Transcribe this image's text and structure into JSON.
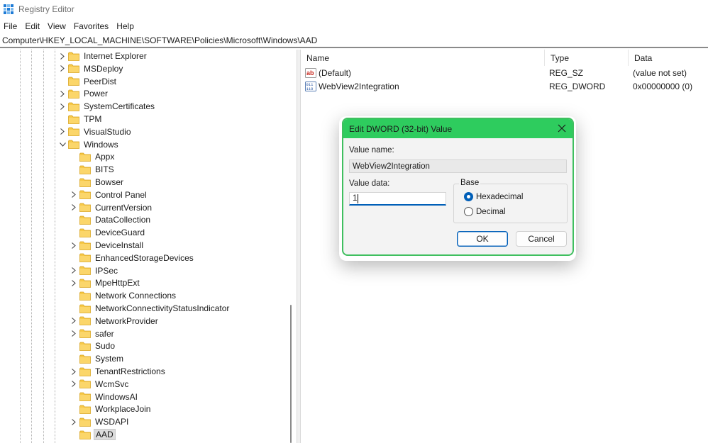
{
  "window": {
    "title": "Registry Editor",
    "icon": "registry-editor-icon"
  },
  "menu": [
    "File",
    "Edit",
    "View",
    "Favorites",
    "Help"
  ],
  "address": "Computer\\HKEY_LOCAL_MACHINE\\SOFTWARE\\Policies\\Microsoft\\Windows\\AAD",
  "tree": {
    "items": [
      {
        "label": "Internet Explorer",
        "expander": "collapsed"
      },
      {
        "label": "MSDeploy",
        "expander": "collapsed"
      },
      {
        "label": "PeerDist",
        "expander": "none"
      },
      {
        "label": "Power",
        "expander": "collapsed"
      },
      {
        "label": "SystemCertificates",
        "expander": "collapsed"
      },
      {
        "label": "TPM",
        "expander": "none"
      },
      {
        "label": "VisualStudio",
        "expander": "collapsed"
      },
      {
        "label": "Windows",
        "expander": "expanded"
      },
      {
        "label": "Appx",
        "expander": "none"
      },
      {
        "label": "BITS",
        "expander": "none"
      },
      {
        "label": "Bowser",
        "expander": "none"
      },
      {
        "label": "Control Panel",
        "expander": "collapsed"
      },
      {
        "label": "CurrentVersion",
        "expander": "collapsed"
      },
      {
        "label": "DataCollection",
        "expander": "none"
      },
      {
        "label": "DeviceGuard",
        "expander": "none"
      },
      {
        "label": "DeviceInstall",
        "expander": "collapsed"
      },
      {
        "label": "EnhancedStorageDevices",
        "expander": "none"
      },
      {
        "label": "IPSec",
        "expander": "collapsed"
      },
      {
        "label": "MpeHttpExt",
        "expander": "collapsed"
      },
      {
        "label": "Network Connections",
        "expander": "none"
      },
      {
        "label": "NetworkConnectivityStatusIndicator",
        "expander": "none"
      },
      {
        "label": "NetworkProvider",
        "expander": "collapsed"
      },
      {
        "label": "safer",
        "expander": "collapsed"
      },
      {
        "label": "Sudo",
        "expander": "none"
      },
      {
        "label": "System",
        "expander": "none"
      },
      {
        "label": "TenantRestrictions",
        "expander": "collapsed"
      },
      {
        "label": "WcmSvc",
        "expander": "collapsed"
      },
      {
        "label": "WindowsAI",
        "expander": "none"
      },
      {
        "label": "WorkplaceJoin",
        "expander": "none"
      },
      {
        "label": "WSDAPI",
        "expander": "collapsed"
      },
      {
        "label": "AAD",
        "expander": "none",
        "selected": true
      }
    ]
  },
  "list": {
    "columns": [
      "Name",
      "Type",
      "Data"
    ],
    "rows": [
      {
        "name": "(Default)",
        "type": "REG_SZ",
        "data": "(value not set)",
        "icon": "string-value-icon"
      },
      {
        "name": "WebView2Integration",
        "type": "REG_DWORD",
        "data": "0x00000000 (0)",
        "icon": "binary-value-icon"
      }
    ]
  },
  "dialog": {
    "title": "Edit DWORD (32-bit) Value",
    "value_name_label": "Value name:",
    "value_name": "WebView2Integration",
    "value_data_label": "Value data:",
    "value_data": "1",
    "base_label": "Base",
    "base_options": [
      {
        "label": "Hexadecimal",
        "checked": true
      },
      {
        "label": "Decimal",
        "checked": false
      }
    ],
    "ok_label": "OK",
    "cancel_label": "Cancel"
  },
  "colors": {
    "dialog_title_bg": "#2ecc5e",
    "dialog_border": "#3fbf5f",
    "folder": "#f7c948",
    "accent": "#005fb8"
  }
}
